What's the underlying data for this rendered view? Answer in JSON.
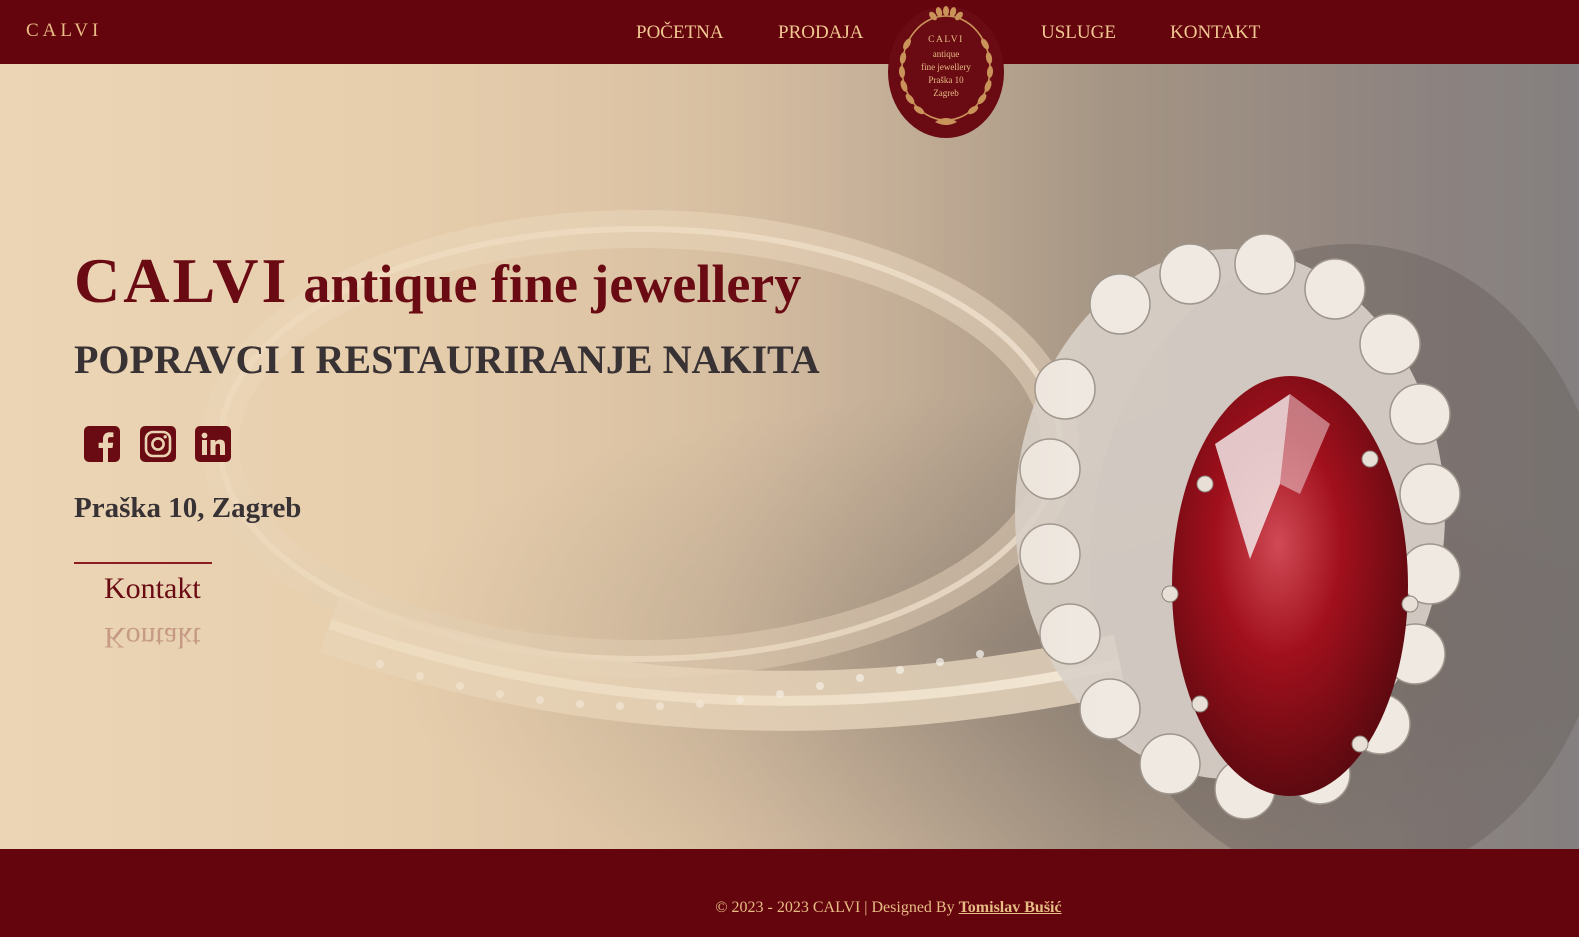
{
  "header": {
    "brand": "CALVI",
    "nav": [
      {
        "label": "POČETNA"
      },
      {
        "label": "PRODAJA"
      },
      {
        "label": "USLUGE"
      },
      {
        "label": "KONTAKT"
      }
    ],
    "emblem_lines": [
      "CALVI",
      "antique",
      "fine jewellery",
      "Praška 10",
      "Zagreb"
    ]
  },
  "hero": {
    "title_main": "CALVI",
    "title_sub": "antique fine jewellery",
    "subtitle": "POPRAVCI I RESTAURIRANJE NAKITA",
    "social": [
      {
        "icon": "facebook-icon"
      },
      {
        "icon": "instagram-icon"
      },
      {
        "icon": "linkedin-icon"
      }
    ],
    "address": "Praška 10, Zagreb",
    "cta_label": "Kontakt",
    "background_image": "ruby-diamond-ring-photo"
  },
  "footer": {
    "copyright": "© 2023 - 2023 CALVI | Designed By",
    "designer": "Tomislav Bušić"
  },
  "colors": {
    "brand_maroon": "#64040c",
    "gold_text": "#e7bd85",
    "title_red": "#6a0a12",
    "dark_text": "#383234",
    "hero_beige": "#e8d1b2",
    "ruby": "#a0101c"
  }
}
